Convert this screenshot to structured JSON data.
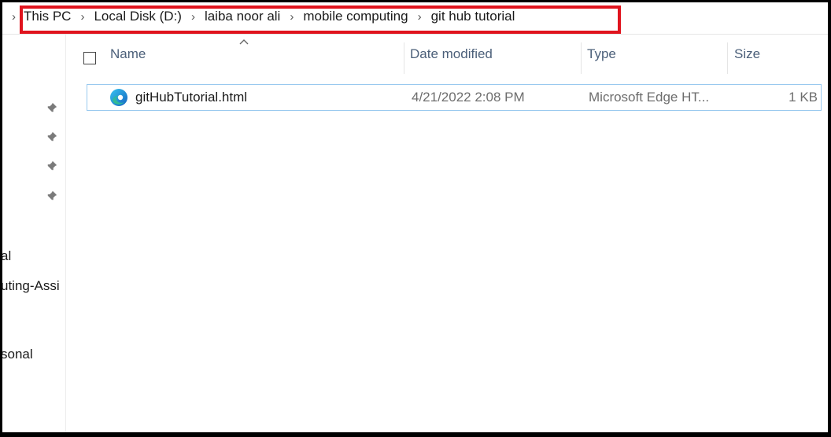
{
  "breadcrumb": {
    "items": [
      "This PC",
      "Local Disk (D:)",
      "laiba noor ali",
      "mobile computing",
      "git hub tutorial"
    ]
  },
  "nav_pane": {
    "items": [
      "al",
      "uting-Assi",
      "sonal"
    ]
  },
  "columns": {
    "name": "Name",
    "date_modified": "Date modified",
    "type": "Type",
    "size": "Size"
  },
  "files": [
    {
      "name": "gitHubTutorial.html",
      "date_modified": "4/21/2022 2:08 PM",
      "type": "Microsoft Edge HT...",
      "size": "1 KB",
      "icon": "edge-icon"
    }
  ],
  "colors": {
    "highlight": "#e0141e",
    "selection_border": "#99c9ef",
    "header_text": "#4c607a"
  }
}
